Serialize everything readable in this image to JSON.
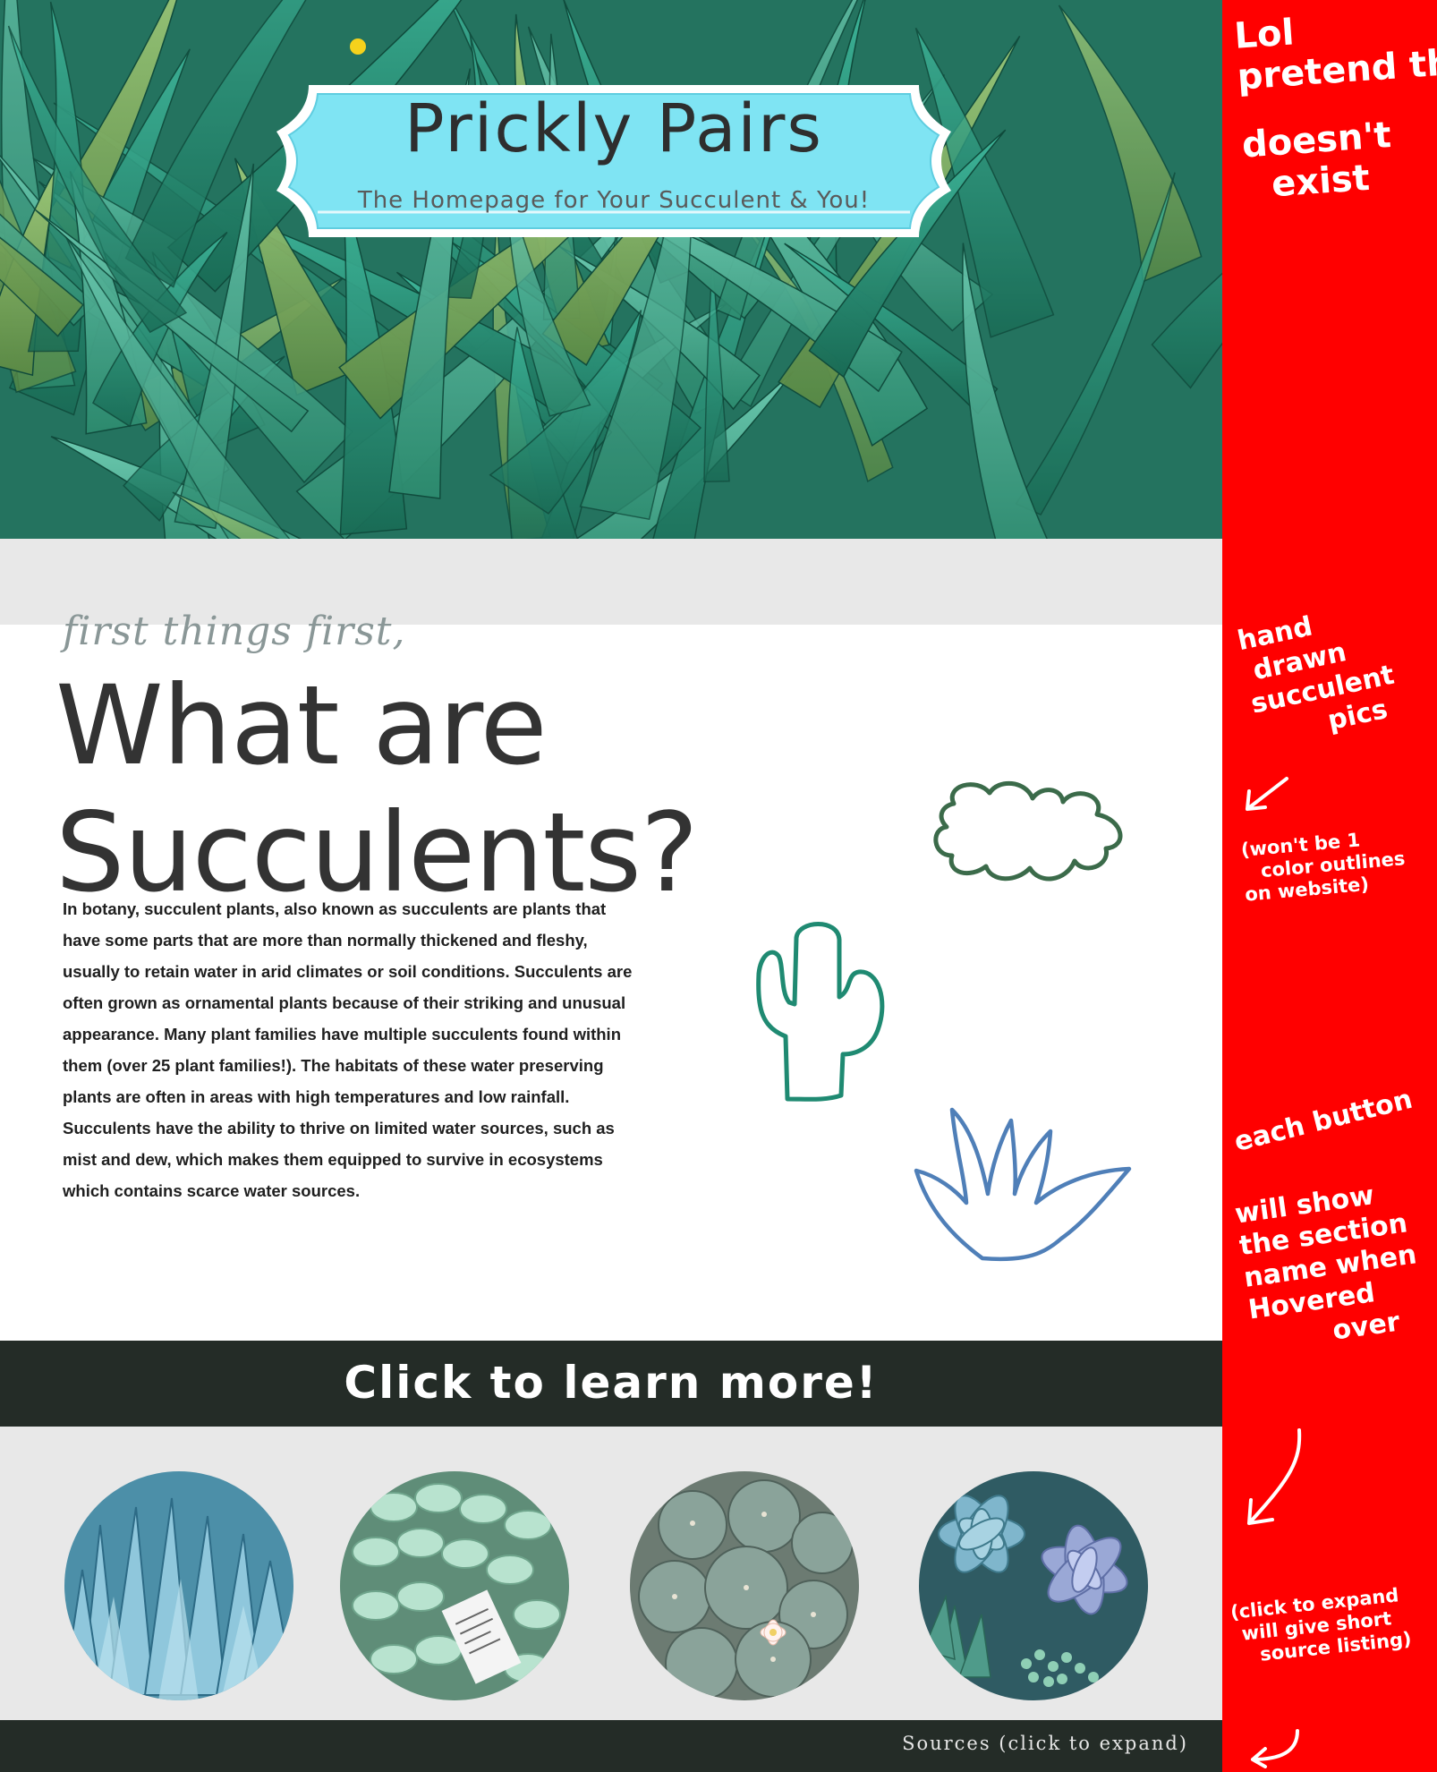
{
  "site": {
    "title": "Prickly Pairs",
    "subtitle": "The Homepage for Your Succulent & You!"
  },
  "intro": {
    "kicker": "first things first,",
    "heading": "What are Succulents?",
    "paragraph": "In botany, succulent plants, also known as succulents are plants that have some parts that are more than normally thickened and fleshy, usually to retain water in arid climates or soil conditions. Succulents are often grown as ornamental plants because of their striking and unusual appearance. Many plant families have multiple succulents found within them (over 25 plant families!). The habitats of these water preserving plants are often in areas with high temperatures and low rainfall. Succulents have the ability to thrive on limited water sources, such as mist and dew, which makes them equipped to survive in ecosystems which contains scarce water sources."
  },
  "cta": {
    "label": "Click to learn more!"
  },
  "footer": {
    "sources_label": "Sources (click to expand)"
  },
  "annotations": {
    "note1": [
      "Lol",
      "pretend this",
      "doesn't",
      "exist"
    ],
    "note2": [
      "hand",
      "drawn",
      "succulent",
      "pics"
    ],
    "note3": [
      "(won't be 1",
      "color outlines",
      "on website)"
    ],
    "note4": [
      "each button",
      "will show",
      "the section",
      "name when",
      "Hovered",
      "over"
    ],
    "note5": [
      "(click to expand",
      "will give short",
      "source listing)"
    ]
  },
  "colors": {
    "banner_fill": "#7fe4f3",
    "dark_bar": "#242c27",
    "grey_band": "#e8e8e8",
    "annotation_panel": "#ff0000",
    "doodle_cloud": "#3b6b4a",
    "doodle_cactus": "#1f8a72",
    "doodle_agave": "#4f7fb8"
  },
  "icons": {
    "cloud_doodle": "cloud-shrub-doodle-icon",
    "cactus_doodle": "cactus-doodle-icon",
    "agave_doodle": "agave-doodle-icon",
    "arrow": "arrow-down-left-icon"
  }
}
